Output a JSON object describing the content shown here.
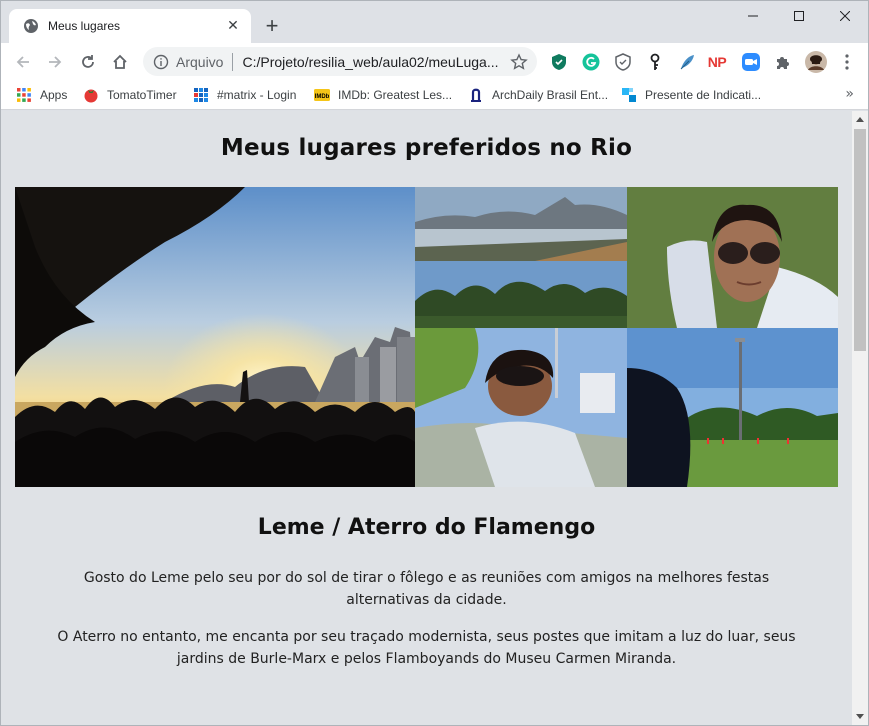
{
  "tab": {
    "title": "Meus lugares",
    "close_glyph": "✕"
  },
  "newtab_glyph": "+",
  "omnibox": {
    "scheme": "Arquivo",
    "url": "C:/Projeto/resilia_web/aula02/meuLuga..."
  },
  "bookmarks": [
    {
      "label": "Apps",
      "icon": "apps-grid-icon"
    },
    {
      "label": "TomatoTimer",
      "icon": "tomato-icon"
    },
    {
      "label": "#matrix - Login",
      "icon": "matrix-grid-icon"
    },
    {
      "label": "IMDb: Greatest Les...",
      "icon": "imdb-icon"
    },
    {
      "label": "ArchDaily Brasil Ent...",
      "icon": "archdaily-icon"
    },
    {
      "label": "Presente de Indicati...",
      "icon": "gift-squares-icon"
    }
  ],
  "bookmarks_more": "»",
  "extensions": [
    "shield-green-icon",
    "grammarly-icon",
    "privacy-shield-icon",
    "key-icon",
    "feather-icon",
    "np-icon",
    "zoom-icon",
    "puzzle-icon",
    "profile-avatar-icon",
    "menu-dots-icon"
  ],
  "extension_text": {
    "np": "NP"
  },
  "page": {
    "title": "Meus lugares preferidos no Rio",
    "section_title": "Leme / Aterro do Flamengo",
    "paragraphs": [
      "Gosto do Leme pelo seu por do sol de tirar o fôlego e as reuniões com amigos na melhores festas alternativas da cidade.",
      "O Aterro no entanto, me encanta por seu traçado modernista, seus postes que imitam a luz do luar, seus jardins de Burle-Marx e pelos Flamboyands do Museu Carmen Miranda."
    ]
  },
  "colors": {
    "chrome_bg": "#dee1e6",
    "toolbar_bg": "#ffffff",
    "page_bg": "#dfe2e6",
    "accent_red": "#e53935"
  }
}
